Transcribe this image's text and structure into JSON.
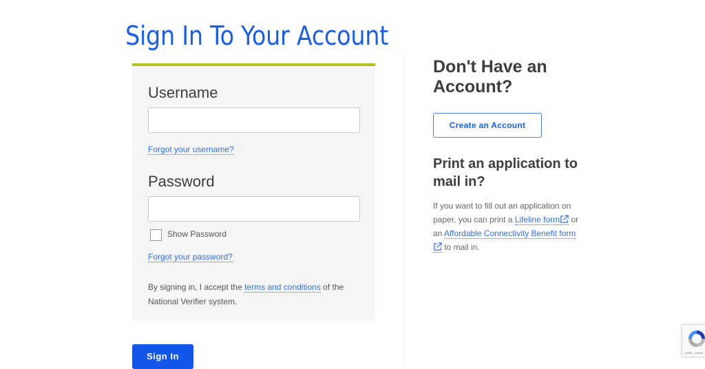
{
  "page": {
    "title": "Sign In To Your Account"
  },
  "login": {
    "username_label": "Username",
    "username_value": "",
    "username_placeholder": "",
    "forgot_username": "Forgot your username?",
    "password_label": "Password",
    "password_value": "",
    "password_placeholder": "",
    "show_password_label": "Show Password",
    "show_password_checked": false,
    "forgot_password": "Forgot your password?",
    "terms_prefix": "By signing in, I accept the ",
    "terms_link": "terms and conditions",
    "terms_suffix": " of the National Verifier system.",
    "signin_label": "Sign In"
  },
  "signup": {
    "heading": "Don't Have an Account?",
    "create_label": "Create an Account"
  },
  "print": {
    "heading": "Print an application to mail in?",
    "text_1": "If you want to fill out an application on paper, you can print a ",
    "lifeline_link": "Lifeline form",
    "text_2": " or an ",
    "acb_link": "Affordable Connectivity Benefit form",
    "text_3": " to mail in."
  },
  "recaptcha": {
    "label": "Gizlilik - Şartlar",
    "icon": "recaptcha-logo"
  },
  "colors": {
    "accent_blue": "#1356e8",
    "title_blue": "#1a5fe0",
    "panel_top_border": "#b5c21b",
    "panel_bg": "#f5f5f5"
  }
}
